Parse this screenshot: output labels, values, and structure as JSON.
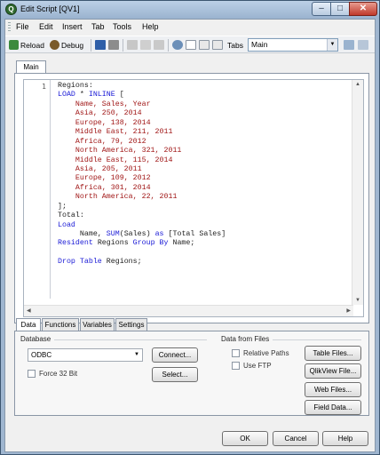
{
  "window": {
    "title": "Edit Script [QV1]",
    "app_icon_glyph": "Q"
  },
  "menu": [
    "File",
    "Edit",
    "Insert",
    "Tab",
    "Tools",
    "Help"
  ],
  "toolbar": {
    "reload_label": "Reload",
    "debug_label": "Debug",
    "tabs_label": "Tabs",
    "tabs_value": "Main"
  },
  "doc_tabs": [
    "Main"
  ],
  "editor": {
    "first_line_number": "1",
    "lines": [
      [
        {
          "t": "plain",
          "s": "Regions:"
        }
      ],
      [
        {
          "t": "kw",
          "s": "LOAD"
        },
        {
          "t": "plain",
          "s": " * "
        },
        {
          "t": "kw",
          "s": "INLINE"
        },
        {
          "t": "plain",
          "s": " ["
        }
      ],
      [
        {
          "t": "str",
          "s": "    Name, Sales, Year"
        }
      ],
      [
        {
          "t": "str",
          "s": "    Asia, 250, 2014"
        }
      ],
      [
        {
          "t": "str",
          "s": "    Europe, 138, 2014"
        }
      ],
      [
        {
          "t": "str",
          "s": "    Middle East, 211, 2011"
        }
      ],
      [
        {
          "t": "str",
          "s": "    Africa, 79, 2012"
        }
      ],
      [
        {
          "t": "str",
          "s": "    North America, 321, 2011"
        }
      ],
      [
        {
          "t": "str",
          "s": "    Middle East, 115, 2014"
        }
      ],
      [
        {
          "t": "str",
          "s": "    Asia, 205, 2011"
        }
      ],
      [
        {
          "t": "str",
          "s": "    Europe, 109, 2012"
        }
      ],
      [
        {
          "t": "str",
          "s": "    Africa, 301, 2014"
        }
      ],
      [
        {
          "t": "str",
          "s": "    North America, 22, 2011"
        }
      ],
      [
        {
          "t": "plain",
          "s": "];"
        }
      ],
      [
        {
          "t": "plain",
          "s": "Total:"
        }
      ],
      [
        {
          "t": "kw",
          "s": "Load"
        }
      ],
      [
        {
          "t": "plain",
          "s": "     Name, "
        },
        {
          "t": "kw",
          "s": "SUM"
        },
        {
          "t": "plain",
          "s": "(Sales) "
        },
        {
          "t": "kw",
          "s": "as"
        },
        {
          "t": "plain",
          "s": " [Total Sales]"
        }
      ],
      [
        {
          "t": "kw",
          "s": "Resident"
        },
        {
          "t": "plain",
          "s": " Regions "
        },
        {
          "t": "kw",
          "s": "Group By"
        },
        {
          "t": "plain",
          "s": " Name;"
        }
      ],
      [
        {
          "t": "plain",
          "s": ""
        }
      ],
      [
        {
          "t": "kw",
          "s": "Drop Table"
        },
        {
          "t": "plain",
          "s": " Regions;"
        }
      ]
    ]
  },
  "bottom_tabs": [
    "Data",
    "Functions",
    "Variables",
    "Settings"
  ],
  "data_panel": {
    "database_label": "Database",
    "database_value": "ODBC",
    "connect_label": "Connect...",
    "select_label": "Select...",
    "force32_label": "Force 32 Bit",
    "files_label": "Data from Files",
    "relative_paths_label": "Relative Paths",
    "use_ftp_label": "Use FTP",
    "table_files_label": "Table Files...",
    "qlikview_file_label": "QlikView File...",
    "web_files_label": "Web Files...",
    "field_data_label": "Field Data..."
  },
  "dialog": {
    "ok_label": "OK",
    "cancel_label": "Cancel",
    "help_label": "Help"
  },
  "colors": {
    "keyword": "#1a1ad6",
    "string": "#a11818",
    "title_bar": "#9fb6d0"
  }
}
